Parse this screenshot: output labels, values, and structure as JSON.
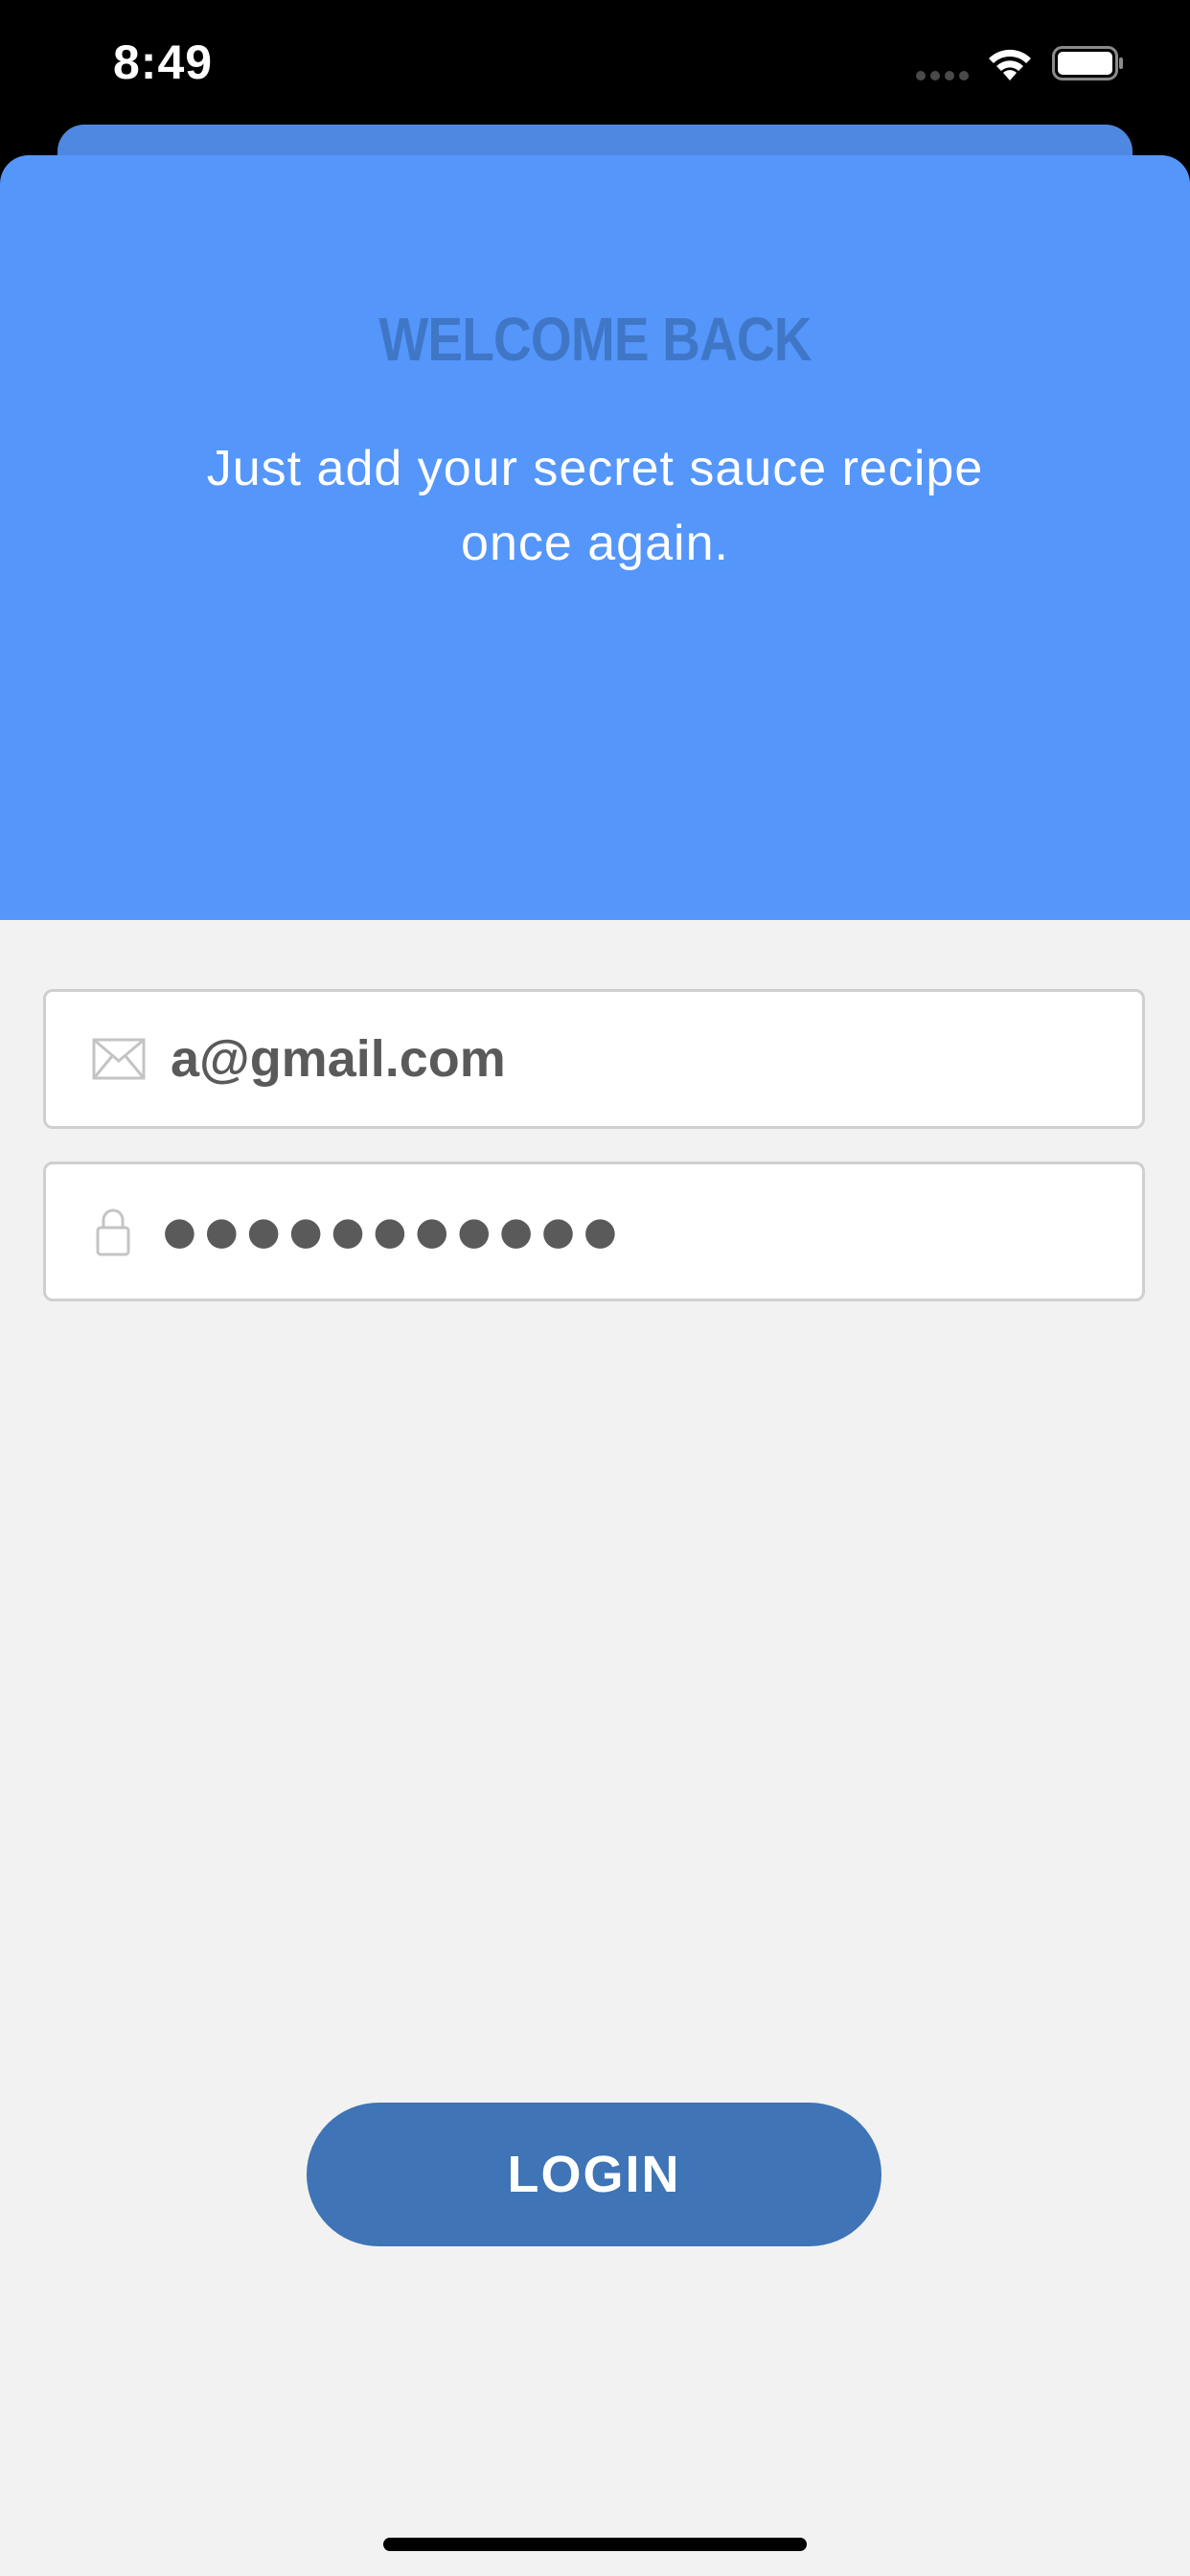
{
  "status_bar": {
    "time": "8:49"
  },
  "hero": {
    "title": "WELCOME BACK",
    "subtitle": "Just add your secret sauce recipe once again."
  },
  "form": {
    "email_value": "a@gmail.com",
    "email_icon": "envelope-icon",
    "password_value": "●●●●●●●●●●●",
    "password_icon": "lock-icon"
  },
  "actions": {
    "login_label": "LOGIN"
  },
  "colors": {
    "hero_background": "#5596fb",
    "hero_title": "#3f77c6",
    "button": "#3f74b6",
    "page_background": "#f2f2f2"
  }
}
